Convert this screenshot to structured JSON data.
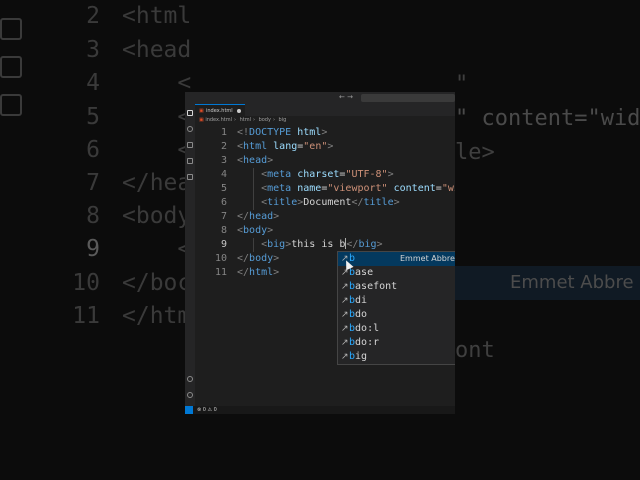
{
  "background": {
    "lines": [
      {
        "num": "2",
        "text": "<html"
      },
      {
        "num": "3",
        "text": "<head"
      },
      {
        "num": "4",
        "text": "    <"
      },
      {
        "num": "5",
        "text": "    <"
      },
      {
        "num": "6",
        "text": "    <"
      },
      {
        "num": "7",
        "text": "</hea"
      },
      {
        "num": "8",
        "text": "<body"
      },
      {
        "num": "9",
        "text": "    <"
      },
      {
        "num": "10",
        "text": "</boc"
      },
      {
        "num": "11",
        "text": "</htm"
      }
    ],
    "right_texts": [
      "\"",
      "\" content=\"wid",
      "le>",
      "Emmet Abbre",
      "ont"
    ]
  },
  "window": {
    "nav_arrows": "← →",
    "tab": {
      "icon": "html-file-icon",
      "label": "index.html"
    },
    "breadcrumb": [
      "index.html",
      "html",
      "body",
      "big"
    ]
  },
  "code": {
    "lines": [
      {
        "num": "1",
        "parts": [
          [
            "punc",
            "<!"
          ],
          [
            "tag",
            "DOCTYPE"
          ],
          [
            "txt",
            " "
          ],
          [
            "attr",
            "html"
          ],
          [
            "punc",
            ">"
          ]
        ]
      },
      {
        "num": "2",
        "parts": [
          [
            "punc",
            "<"
          ],
          [
            "tag",
            "html"
          ],
          [
            "txt",
            " "
          ],
          [
            "attr",
            "lang"
          ],
          [
            "txt",
            "="
          ],
          [
            "str",
            "\"en\""
          ],
          [
            "punc",
            ">"
          ]
        ]
      },
      {
        "num": "3",
        "parts": [
          [
            "punc",
            "<"
          ],
          [
            "tag",
            "head"
          ],
          [
            "punc",
            ">"
          ]
        ]
      },
      {
        "num": "4",
        "parts": [
          [
            "txt",
            "    "
          ],
          [
            "punc",
            "<"
          ],
          [
            "tag",
            "meta"
          ],
          [
            "txt",
            " "
          ],
          [
            "attr",
            "charset"
          ],
          [
            "txt",
            "="
          ],
          [
            "str",
            "\"UTF-8\""
          ],
          [
            "punc",
            ">"
          ]
        ]
      },
      {
        "num": "5",
        "parts": [
          [
            "txt",
            "    "
          ],
          [
            "punc",
            "<"
          ],
          [
            "tag",
            "meta"
          ],
          [
            "txt",
            " "
          ],
          [
            "attr",
            "name"
          ],
          [
            "txt",
            "="
          ],
          [
            "str",
            "\"viewport\""
          ],
          [
            "txt",
            " "
          ],
          [
            "attr",
            "content"
          ],
          [
            "txt",
            "="
          ],
          [
            "str",
            "\"wid"
          ]
        ]
      },
      {
        "num": "6",
        "parts": [
          [
            "txt",
            "    "
          ],
          [
            "punc",
            "<"
          ],
          [
            "tag",
            "title"
          ],
          [
            "punc",
            ">"
          ],
          [
            "txt",
            "Document"
          ],
          [
            "punc",
            "</"
          ],
          [
            "tag",
            "title"
          ],
          [
            "punc",
            ">"
          ]
        ]
      },
      {
        "num": "7",
        "parts": [
          [
            "punc",
            "</"
          ],
          [
            "tag",
            "head"
          ],
          [
            "punc",
            ">"
          ]
        ]
      },
      {
        "num": "8",
        "parts": [
          [
            "punc",
            "<"
          ],
          [
            "tag",
            "body"
          ],
          [
            "punc",
            ">"
          ]
        ]
      },
      {
        "num": "9",
        "parts": [
          [
            "txt",
            "    "
          ],
          [
            "punc",
            "<"
          ],
          [
            "tag",
            "big"
          ],
          [
            "punc",
            ">"
          ],
          [
            "txt",
            "this is b"
          ],
          [
            "cursor",
            ""
          ],
          [
            "punc",
            "</"
          ],
          [
            "tag",
            "big"
          ],
          [
            "punc",
            ">"
          ]
        ]
      },
      {
        "num": "10",
        "parts": [
          [
            "punc",
            "</"
          ],
          [
            "tag",
            "body"
          ],
          [
            "punc",
            ">"
          ]
        ]
      },
      {
        "num": "11",
        "parts": [
          [
            "punc",
            "</"
          ],
          [
            "tag",
            "html"
          ],
          [
            "punc",
            ">"
          ]
        ]
      }
    ],
    "active_line": "9"
  },
  "suggest": {
    "items": [
      {
        "label": "b",
        "detail": "Emmet Abbre",
        "selected": true
      },
      {
        "label": "base"
      },
      {
        "label": "basefont"
      },
      {
        "label": "bdi"
      },
      {
        "label": "bdo"
      },
      {
        "label": "bdo:l"
      },
      {
        "label": "bdo:r"
      },
      {
        "label": "big"
      }
    ],
    "icon": "wrench-icon"
  },
  "status": {
    "text": "⊗ 0 ⚠ 0"
  },
  "colors": {
    "editor_bg": "#1e1e1e",
    "tag": "#569cd6",
    "attr": "#9cdcfe",
    "string": "#ce9178",
    "selected_bg": "#04395e",
    "match": "#2aaaff"
  }
}
